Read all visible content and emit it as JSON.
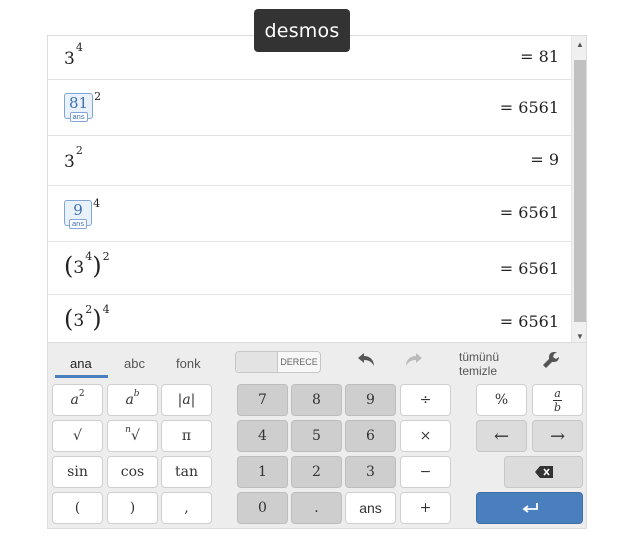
{
  "brand": "desmos",
  "rows": [
    {
      "base": "3",
      "exp": "4",
      "result": "= 81"
    },
    {
      "ans_value": "81",
      "ans_tag": "ans",
      "exp": "2",
      "result": "= 6561"
    },
    {
      "base": "3",
      "exp": "2",
      "result": "= 9"
    },
    {
      "ans_value": "9",
      "ans_tag": "ans",
      "exp": "4",
      "result": "= 6561"
    },
    {
      "open": "(",
      "base": "3",
      "inner_exp": "4",
      "close": ")",
      "exp": "2",
      "result": "= 6561"
    },
    {
      "open": "(",
      "base": "3",
      "inner_exp": "2",
      "close": ")",
      "exp": "4",
      "result": "= 6561"
    }
  ],
  "keypad": {
    "tabs": [
      "ana",
      "abc",
      "fonk"
    ],
    "toggle_label": "DERECE",
    "clear_all": [
      "tümünü",
      "temizle"
    ],
    "keys": {
      "a2": {
        "base": "a",
        "sup": "2"
      },
      "ab": {
        "base": "a",
        "sup": "b"
      },
      "abs": "|a|",
      "sqrt": "√",
      "nroot_n": "n",
      "nroot": "√",
      "pi": "π",
      "sin": "sin",
      "cos": "cos",
      "tan": "tan",
      "lparen": "(",
      "rparen": ")",
      "comma": ",",
      "n7": "7",
      "n8": "8",
      "n9": "9",
      "n4": "4",
      "n5": "5",
      "n6": "6",
      "n1": "1",
      "n2": "2",
      "n3": "3",
      "n0": "0",
      "dot": ".",
      "ans": "ans",
      "div": "÷",
      "mul": "×",
      "minus": "−",
      "plus": "+",
      "percent": "%",
      "frac_top": "a",
      "frac_bottom": "b",
      "left": "←",
      "right": "→",
      "backspace": "⌫",
      "enter": "↵"
    }
  }
}
